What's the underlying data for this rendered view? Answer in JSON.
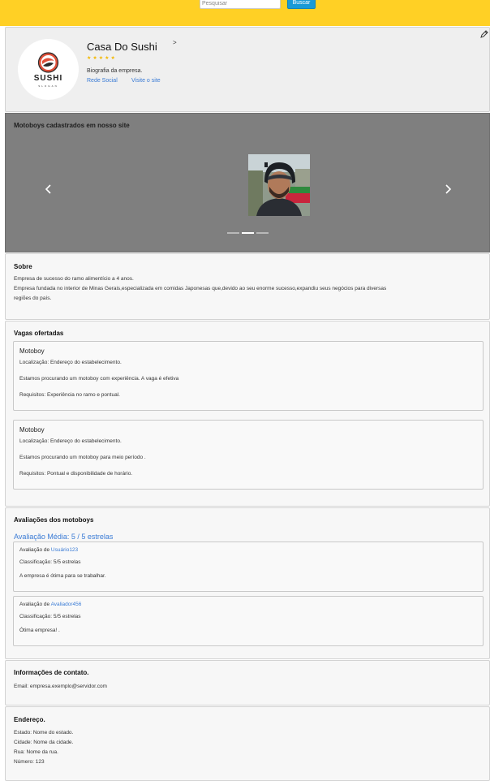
{
  "header": {
    "search_placeholder": "Pesquisar",
    "search_button": "Buscar",
    "bar_color": "#ffd025"
  },
  "profile": {
    "logo_text": "SUSHI",
    "logo_slogan": "SLOGAN",
    "name": "Casa Do Sushi",
    "name_arrow": ">",
    "rating_stars": 5,
    "stars": "★★★★★",
    "bio": "Biografia da empresa.",
    "link_social": "Rede Social",
    "link_site": "Visite o site",
    "edit_icon": "pencil-icon"
  },
  "carousel": {
    "title": "Motoboys cadastrados em nosso site",
    "prev_icon": "chevron-left-icon",
    "next_icon": "chevron-right-icon",
    "slide_count": 3,
    "active_slide": 2
  },
  "sobre": {
    "title": "Sobre",
    "line1": "Empresa de sucesso do ramo alimentício a 4 anos.",
    "line2": "Empresa fundada no interior de Minas Gerais,especializada em comidas Japonesas que,devido ao seu enorme sucesso,expandiu seus negócios para diversas",
    "line3": "regiões do país."
  },
  "vagas": {
    "title": "Vagas ofertadas",
    "jobs": [
      {
        "title": "Motoboy",
        "location": "Localização: Endereço do estabelecimento.",
        "description": "Estamos procurando um motoboy com experiência. A vaga é efetiva",
        "requirements": "Requisitos: Experiência no ramo e pontual."
      },
      {
        "title": "Motoboy",
        "location": "Localização: Endereço do estabelecimento.",
        "description": "Estamos procurando um motoboy para meio período .",
        "requirements": "Requisitos: Pontual e disponibilidade de horário."
      }
    ]
  },
  "avaliacoes": {
    "title": "Avaliações dos motoboys",
    "average": "Avaliação Média: 5 / 5 estrelas",
    "reviews": [
      {
        "prefix": "Avaliação de ",
        "user": "Usuário123",
        "classification": "Classificação: 5/5 estrelas",
        "comment": "A empresa é ótima para se trabalhar."
      },
      {
        "prefix": "Avaliação de ",
        "user": "Avaliador456",
        "classification": "Classificação: 5/5 estrelas",
        "comment": "Ótima empresa! ."
      }
    ]
  },
  "contato": {
    "title": "Informações de contato.",
    "email": "Email: empresa.exemplo@servidor.com"
  },
  "endereco": {
    "title": "Endereço.",
    "estado": "Estado: Nome do estado.",
    "cidade": "Cidade: Nome da cidade.",
    "rua": "Rua: Nome da rua.",
    "numero": "Número: 123"
  }
}
